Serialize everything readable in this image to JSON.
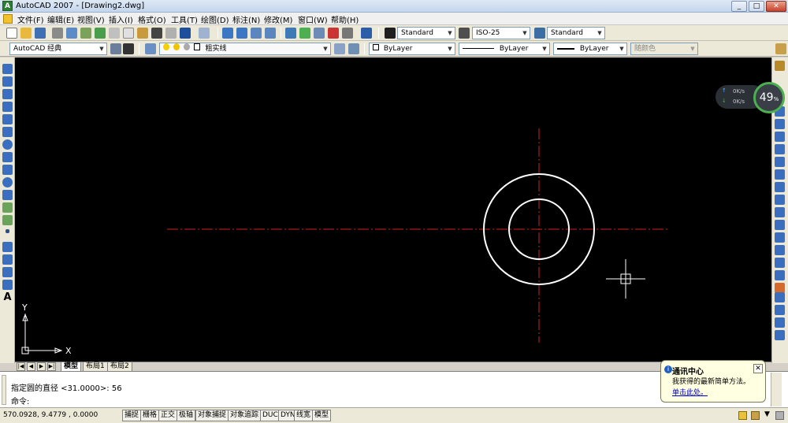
{
  "window": {
    "title": "AutoCAD 2007 - [Drawing2.dwg]",
    "app_icon_letter": "A"
  },
  "menu": {
    "items": [
      "文件(F)",
      "编辑(E)",
      "视图(V)",
      "插入(I)",
      "格式(O)",
      "工具(T)",
      "绘图(D)",
      "标注(N)",
      "修改(M)",
      "窗口(W)",
      "帮助(H)"
    ]
  },
  "toolbar": {
    "text_style": "Standard",
    "dim_style": "ISO-25",
    "table_style": "Standard",
    "workspace": "AutoCAD 经典",
    "layer": "粗实线",
    "color": "ByLayer",
    "linetype": "ByLayer",
    "lineweight": "ByLayer",
    "plotstyle": "随颜色"
  },
  "speed_widget": {
    "upload": "0K/s",
    "download": "0K/s",
    "percent": "49",
    "percent_unit": "%"
  },
  "canvas": {
    "ucs_x": "X",
    "ucs_y": "Y"
  },
  "layout_tabs": {
    "model": "模型",
    "layout1": "布局1",
    "layout2": "布局2"
  },
  "command": {
    "line1": "指定圆的直径 <31.0000>: 56",
    "line2": "命令:"
  },
  "status": {
    "coords": "570.0928, 9.4779 , 0.0000",
    "buttons": [
      "捕捉",
      "栅格",
      "正交",
      "极轴",
      "对象捕捉",
      "对象追踪",
      "DUCS",
      "DYN",
      "线宽",
      "模型"
    ]
  },
  "balloon": {
    "title": "通讯中心",
    "text": "我获得的最新简单方法。",
    "link": "单击此处。",
    "close": "✕"
  },
  "colors": {
    "canvas_bg": "#000000",
    "circle": "#ffffff",
    "centerline": "#cc1f1f"
  }
}
